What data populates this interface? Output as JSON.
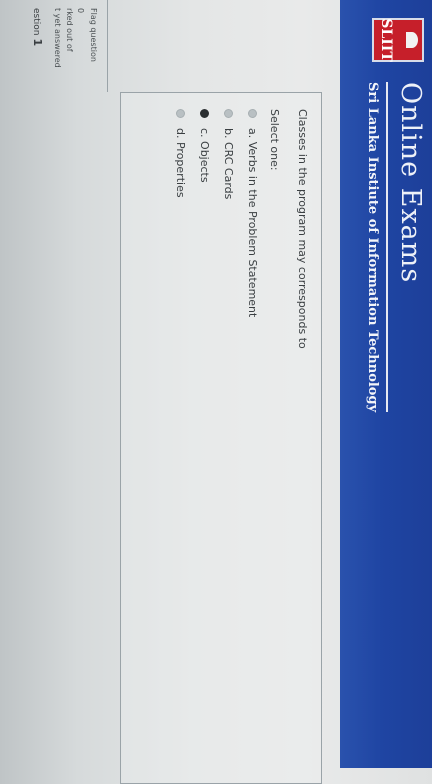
{
  "header": {
    "logo_text": "SLIIT",
    "title": "Online Exams",
    "subtitle": "Sri Lanka Instiute of Information Technology"
  },
  "question_nav": {
    "title_prefix": "estion",
    "number": "1",
    "status": "t yet answered",
    "marked_out_of": "rked out of",
    "marks": "0",
    "flag_label": "Flag question"
  },
  "question": {
    "text": "Classes in the program may corresponds to",
    "select_label": "Select one:",
    "options": [
      {
        "label": "a. Verbs in the Problem Statement",
        "selected": false
      },
      {
        "label": "b. CRC Cards",
        "selected": false
      },
      {
        "label": "c. Objects",
        "selected": true
      },
      {
        "label": "d. Properties",
        "selected": false
      }
    ]
  },
  "colors": {
    "header_blue": "#1f45a3",
    "logo_red": "#c61f2a"
  }
}
